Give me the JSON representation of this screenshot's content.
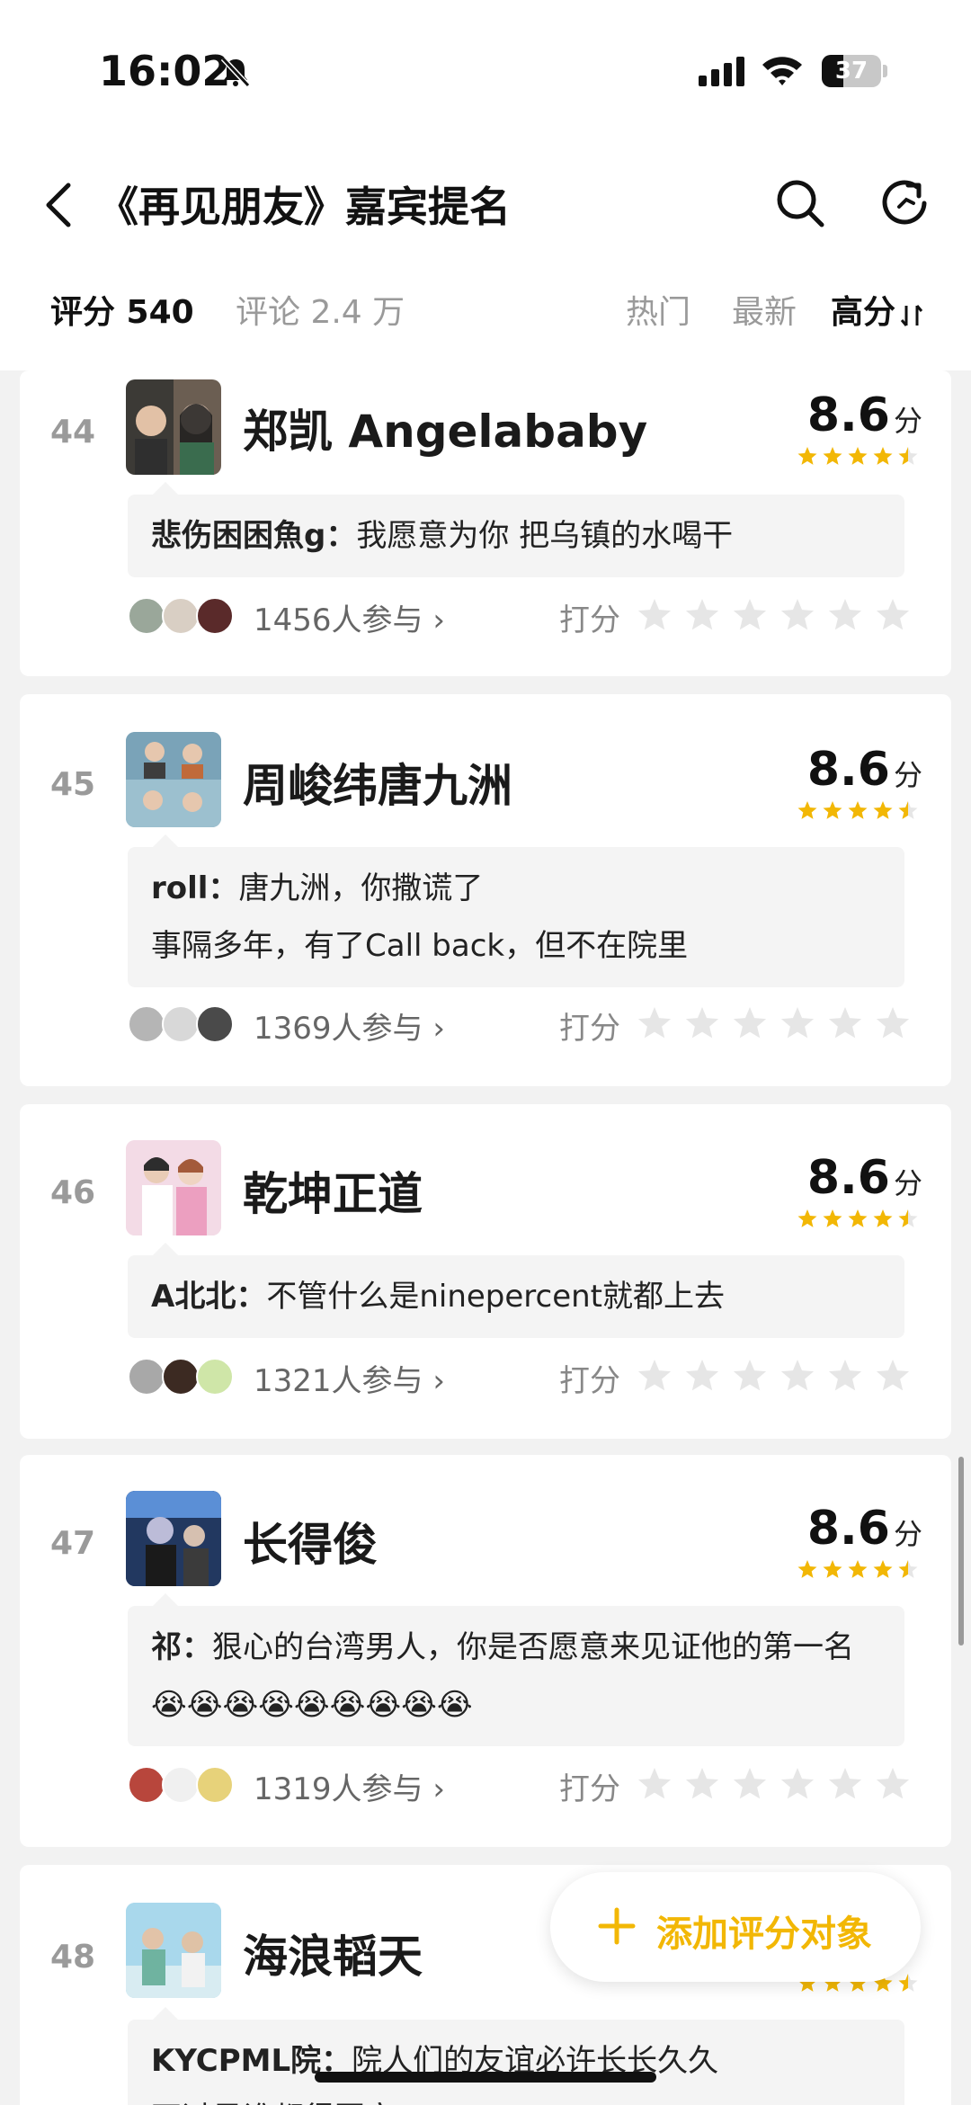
{
  "status_bar": {
    "time": "16:02",
    "battery": "37",
    "battery_level": 0.37
  },
  "header": {
    "title": "《再见朋友》嘉宾提名"
  },
  "tabs": {
    "rating": "评分 540",
    "comments": "评论 2.4 万",
    "hot": "热门",
    "newest": "最新",
    "high": "高分"
  },
  "rate_label": "打分",
  "score_unit": "分",
  "items": [
    {
      "rank": "44",
      "name": "郑凯 Angelababy",
      "score": "8.6",
      "comment_user": "悲伤困困魚g：",
      "comment_text": "我愿意为你 把乌镇的水喝干",
      "participants": "1456人参与 ›"
    },
    {
      "rank": "45",
      "name": "周峻纬唐九洲",
      "score": "8.6",
      "comment_user": "roll：",
      "comment_text": "唐九洲，你撒谎了",
      "comment_text2": "事隔多年，有了Call back，但不在院里",
      "participants": "1369人参与 ›"
    },
    {
      "rank": "46",
      "name": "乾坤正道",
      "score": "8.6",
      "comment_user": "A北北：",
      "comment_text": "不管什么是ninepercent就都上去",
      "participants": "1321人参与 ›"
    },
    {
      "rank": "47",
      "name": "长得俊",
      "score": "8.6",
      "comment_user": "祁：",
      "comment_text": "狠心的台湾男人，你是否愿意来见证他的第一名😭😭😭😭😭😭😭😭😭",
      "participants": "1319人参与 ›"
    },
    {
      "rank": "48",
      "name": "海浪韬天",
      "comment_user": "KYCPML院：",
      "comment_text": "院人们的友谊必许长长久久",
      "comment_text2": "不过是谁都得回家"
    }
  ],
  "fab": {
    "label": "添加评分对象"
  },
  "colors": {
    "accent": "#f2b705",
    "star_empty": "#e6e6e6"
  }
}
